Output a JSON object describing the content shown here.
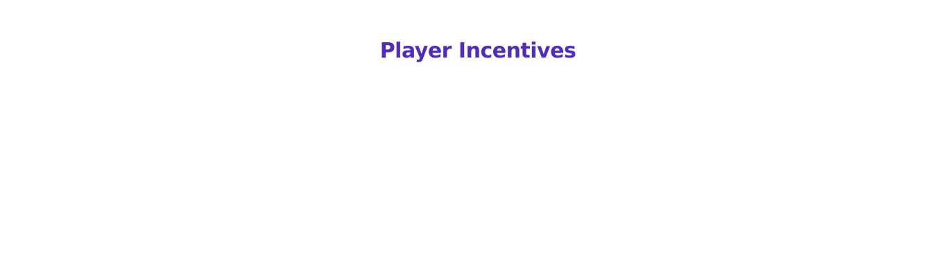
{
  "section": {
    "title": "Player Incentives"
  },
  "colors": {
    "title": "#512bbf",
    "background": "#ffffff"
  }
}
